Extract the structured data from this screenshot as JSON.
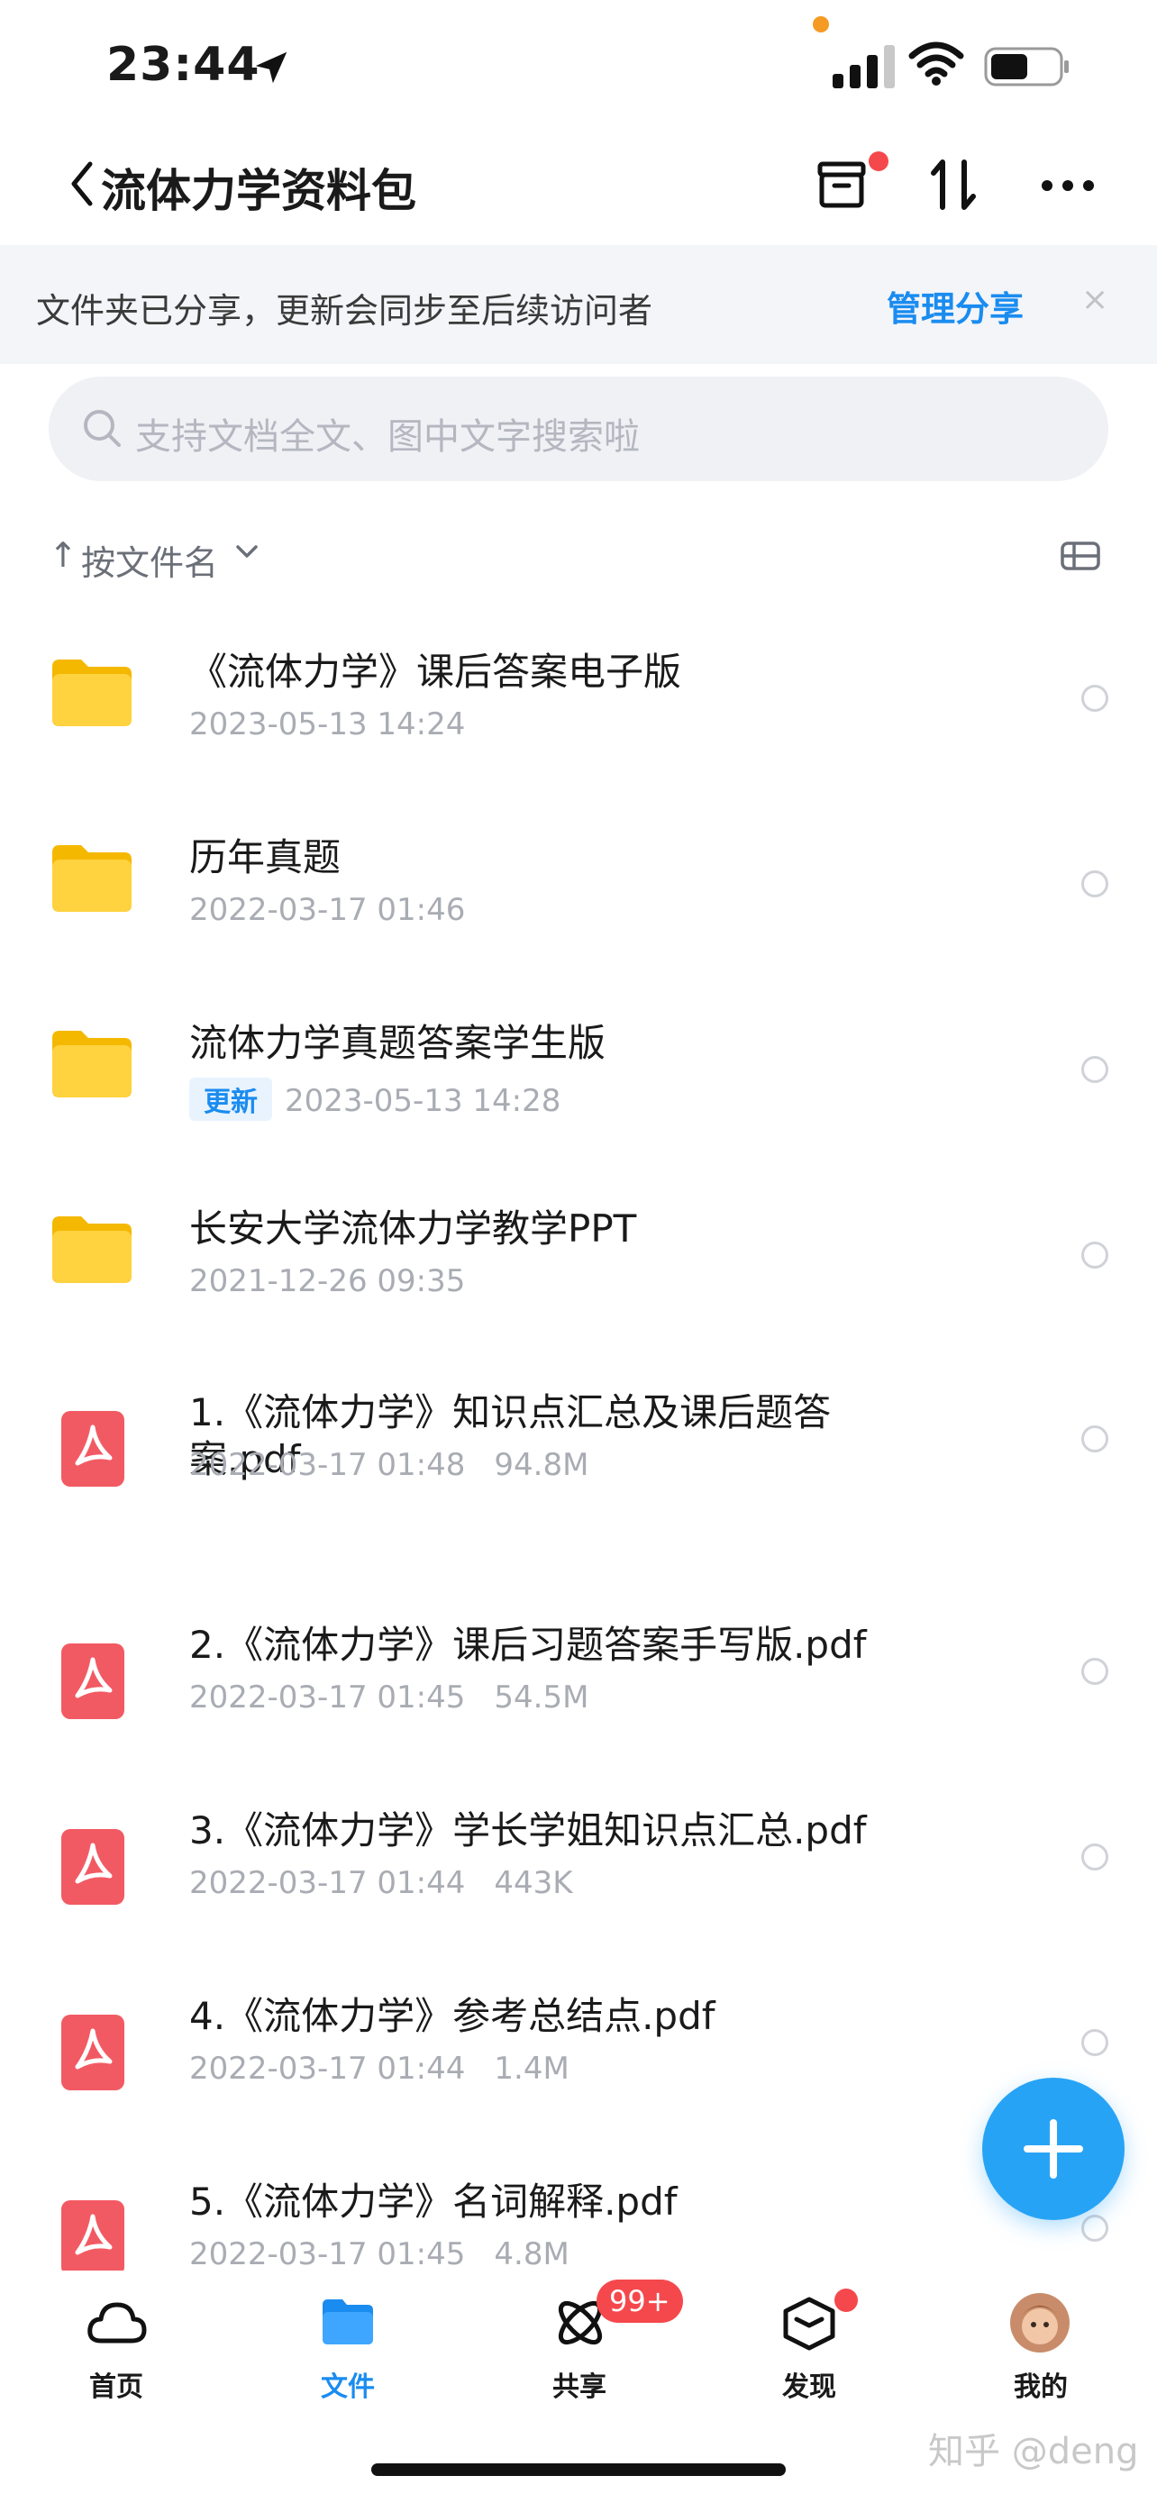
{
  "status_bar": {
    "time": "23:44"
  },
  "header": {
    "title": "流体力学资料包"
  },
  "banner": {
    "text": "文件夹已分享，更新会同步至后续访问者",
    "link": "管理分享",
    "close": "×"
  },
  "search": {
    "placeholder": "支持文档全文、图中文字搜索啦"
  },
  "sort": {
    "arrow": "↑",
    "label": "按文件名"
  },
  "items": [
    {
      "type": "folder",
      "name": "《流体力学》课后答案电子版",
      "date": "2023-05-13 14:24"
    },
    {
      "type": "folder",
      "name": "历年真题",
      "date": "2022-03-17 01:46"
    },
    {
      "type": "folder",
      "name": "流体力学真题答案学生版",
      "tag": "更新",
      "date": "2023-05-13 14:28"
    },
    {
      "type": "folder",
      "name": "长安大学流体力学教学PPT",
      "date": "2021-12-26 09:35"
    },
    {
      "type": "pdf",
      "name": "1.《流体力学》知识点汇总及课后题答案.pdf",
      "date": "2022-03-17 01:48",
      "size": "94.8M"
    },
    {
      "type": "pdf",
      "name": "2.《流体力学》课后习题答案手写版.pdf",
      "date": "2022-03-17 01:45",
      "size": "54.5M"
    },
    {
      "type": "pdf",
      "name": "3.《流体力学》学长学姐知识点汇总.pdf",
      "date": "2022-03-17 01:44",
      "size": "443K"
    },
    {
      "type": "pdf",
      "name": "4.《流体力学》参考总结点.pdf",
      "date": "2022-03-17 01:44",
      "size": "1.4M"
    },
    {
      "type": "pdf",
      "name": "5.《流体力学》名词解释.pdf",
      "date": "2022-03-17 01:45",
      "size": "4.8M"
    }
  ],
  "tabbar": {
    "tabs": [
      {
        "label": "首页",
        "icon": "cloud-icon"
      },
      {
        "label": "文件",
        "icon": "folder-icon",
        "active": true
      },
      {
        "label": "共享",
        "icon": "atom-icon",
        "badge": "99+"
      },
      {
        "label": "发现",
        "icon": "cube-icon"
      },
      {
        "label": "我的",
        "icon": "avatar"
      }
    ]
  },
  "watermark": "知乎 @deng",
  "colors": {
    "accent": "#1a8cf0",
    "folder": "#ffd23f",
    "pdf": "#f25a63",
    "badge": "#f5484c"
  }
}
